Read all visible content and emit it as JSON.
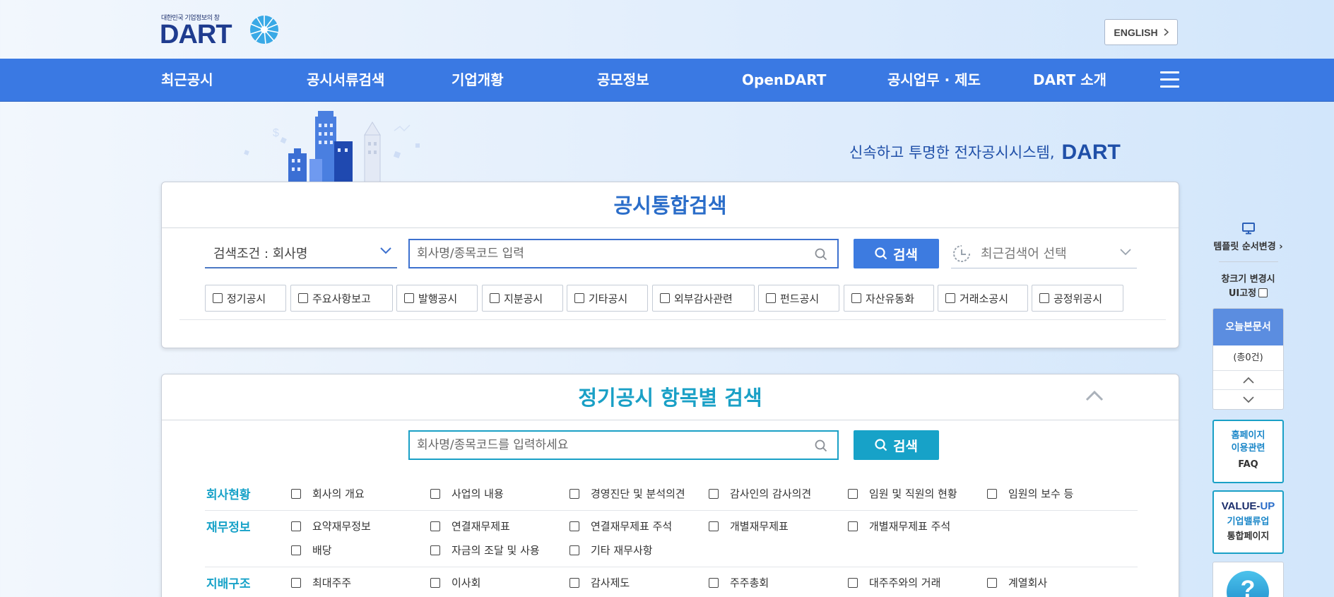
{
  "header": {
    "logo_tagline": "대한민국 기업정보의 창",
    "logo_word": "DART",
    "english_button": "ENGLISH"
  },
  "nav": {
    "items": [
      "최근공시",
      "공시서류검색",
      "기업개황",
      "공모정보",
      "OpenDART",
      "공시업무 · 제도",
      "DART 소개"
    ]
  },
  "hero": {
    "slogan": "신속하고 투명한 전자공시시스템,",
    "slogan_brand": "DART"
  },
  "integrated_search": {
    "title": "공시통합검색",
    "condition_select": "검색조건 : 회사명",
    "search_placeholder": "회사명/종목코드 입력",
    "search_button": "검색",
    "recent_select": "최근검색어 선택",
    "filters": [
      "정기공시",
      "주요사항보고",
      "발행공시",
      "지분공시",
      "기타공시",
      "외부감사관련",
      "펀드공시",
      "자산유동화",
      "거래소공시",
      "공정위공시"
    ]
  },
  "periodic_search": {
    "title": "정기공시 항목별 검색",
    "search_placeholder": "회사명/종목코드를 입력하세요",
    "search_button": "검색",
    "categories": [
      {
        "name": "회사현황",
        "rows": [
          [
            "회사의 개요",
            "사업의 내용",
            "경영진단 및 분석의견",
            "감사인의 감사의견",
            "임원 및 직원의 현황",
            "임원의 보수 등"
          ]
        ]
      },
      {
        "name": "재무정보",
        "rows": [
          [
            "요약재무정보",
            "연결재무제표",
            "연결재무제표 주석",
            "개별재무제표",
            "개별재무제표 주석"
          ],
          [
            "배당",
            "자금의 조달 및 사용",
            "기타 재무사항"
          ]
        ]
      },
      {
        "name": "지배구조",
        "rows": [
          [
            "최대주주",
            "이사회",
            "감사제도",
            "주주총회",
            "대주주와의 거래",
            "계열회사"
          ]
        ]
      }
    ]
  },
  "side_panel": {
    "template_order": "템플릿 순서변경",
    "window_fix_line1": "창크기 변경시",
    "window_fix_line2": "UI고정",
    "today_docs_title": "오늘본문서",
    "today_docs_count": "(총0건)",
    "faq_line1": "홈페이지",
    "faq_line2": "이용관련",
    "faq_line3": "FAQ",
    "valueup_brand": "VALUE-",
    "valueup_brand_accent": "UP",
    "valueup_line2": "기업밸류업",
    "valueup_line3": "통합페이지",
    "help_icon_glyph": "?"
  },
  "colors": {
    "nav_blue": "#3a79e3",
    "primary_blue": "#2a6dc9",
    "teal": "#17a2c8",
    "logo_navy": "#1f3c8f"
  }
}
